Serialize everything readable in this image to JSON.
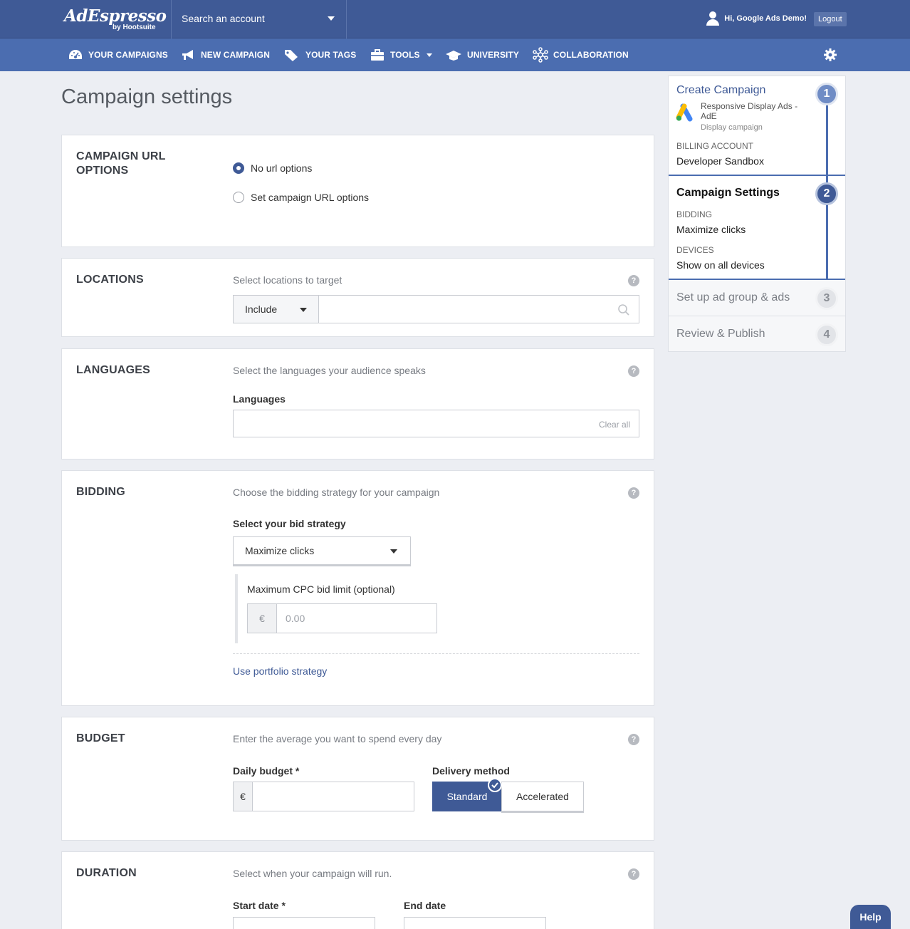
{
  "header": {
    "logo_main": "AdEspresso",
    "logo_sub": "by Hootsuite",
    "account_search_placeholder": "Search an account",
    "greeting": "Hi, Google Ads Demo!",
    "logout_label": "Logout"
  },
  "nav": {
    "items": [
      {
        "label": "YOUR CAMPAIGNS",
        "icon": "dashboard-icon"
      },
      {
        "label": "NEW CAMPAIGN",
        "icon": "megaphone-icon"
      },
      {
        "label": "YOUR TAGS",
        "icon": "tags-icon"
      },
      {
        "label": "TOOLS",
        "icon": "briefcase-icon"
      },
      {
        "label": "UNIVERSITY",
        "icon": "graduation-cap-icon"
      },
      {
        "label": "COLLABORATION",
        "icon": "network-icon"
      }
    ],
    "settings_icon": "gear-icon"
  },
  "page": {
    "title": "Campaign settings"
  },
  "url_options": {
    "title": "CAMPAIGN URL OPTIONS",
    "options": [
      {
        "label": "No url options",
        "selected": true
      },
      {
        "label": "Set campaign URL options",
        "selected": false
      }
    ]
  },
  "locations": {
    "title": "LOCATIONS",
    "description": "Select locations to target",
    "mode": "Include",
    "search_value": ""
  },
  "languages": {
    "title": "LANGUAGES",
    "description": "Select the languages your audience speaks",
    "field_label": "Languages",
    "clear_label": "Clear all"
  },
  "bidding": {
    "title": "BIDDING",
    "description": "Choose the bidding strategy for your campaign",
    "strategy_label": "Select your bid strategy",
    "strategy_value": "Maximize clicks",
    "cpc_label": "Maximum CPC bid limit (optional)",
    "currency": "€",
    "cpc_placeholder": "0.00",
    "portfolio_link": "Use portfolio strategy"
  },
  "budget": {
    "title": "BUDGET",
    "description": "Enter the average you want to spend every day",
    "daily_label": "Daily budget *",
    "currency": "€",
    "delivery_label": "Delivery method",
    "delivery_options": [
      "Standard",
      "Accelerated"
    ],
    "delivery_selected": "Standard"
  },
  "duration": {
    "title": "DURATION",
    "description": "Select when your campaign will run.",
    "start_label": "Start date *",
    "end_label": "End date"
  },
  "stepper": {
    "steps": [
      {
        "number": "1",
        "title": "Create Campaign",
        "state": "done"
      },
      {
        "number": "2",
        "title": "Campaign Settings",
        "state": "active"
      },
      {
        "number": "3",
        "title": "Set up ad group & ads",
        "state": "todo"
      },
      {
        "number": "4",
        "title": "Review & Publish",
        "state": "todo"
      }
    ],
    "campaign_name": "Responsive Display Ads - AdE",
    "campaign_type": "Display campaign",
    "billing_label": "BILLING ACCOUNT",
    "billing_value": "Developer Sandbox",
    "bidding_label": "BIDDING",
    "bidding_value": "Maximize clicks",
    "devices_label": "DEVICES",
    "devices_value": "Show on all devices"
  },
  "help_button": "Help",
  "colors": {
    "primary": "#3f5a96",
    "nav": "#4b6db0",
    "background": "#eceef3"
  }
}
